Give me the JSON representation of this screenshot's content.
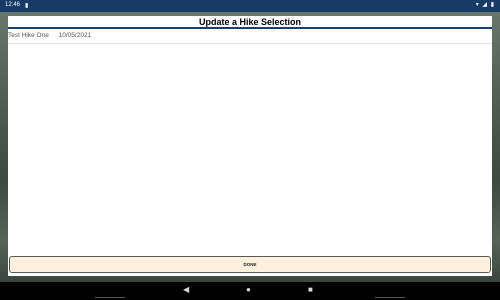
{
  "status_bar": {
    "time": "12:46",
    "left_icon": "clipboard-icon",
    "right_icons": "wifi-icon signal-icon battery-icon"
  },
  "screen": {
    "title": "Update a Hike Selection",
    "hikes": [
      {
        "name": "Test Hike One",
        "date": "10/05/2021"
      }
    ],
    "done_button_label": "DONE"
  },
  "nav_bar": {
    "back": "back-icon",
    "home": "home-icon",
    "recent": "recent-apps-icon"
  },
  "colors": {
    "status_bar_bg": "#173a66",
    "title_underline": "#1b3f73",
    "button_bg": "#fdf1de"
  }
}
